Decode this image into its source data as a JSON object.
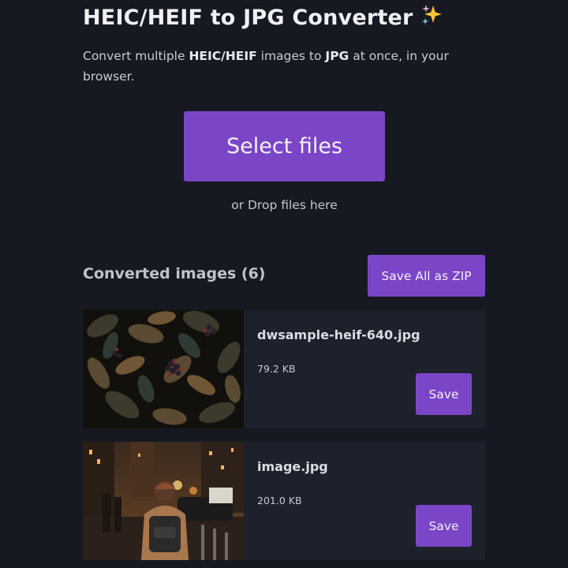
{
  "header": {
    "title": "HEIC/HEIF to JPG Converter",
    "title_icon": "sparkles-icon",
    "subtitle": {
      "prefix": "Convert multiple ",
      "format_from": "HEIC/HEIF",
      "middle": " images to ",
      "format_to": "JPG",
      "suffix": " at once, in your browser."
    }
  },
  "upload": {
    "select_label": "Select files",
    "drop_hint": "or Drop files here"
  },
  "converted": {
    "heading": "Converted images (6)",
    "save_all_label": "Save All as ZIP",
    "items": [
      {
        "filename": "dwsample-heif-640.jpg",
        "size": "79.2 KB",
        "save_label": "Save",
        "thumbnail": "leaves-and-berries-photo"
      },
      {
        "filename": "image.jpg",
        "size": "201.0 KB",
        "save_label": "Save",
        "thumbnail": "city-street-night-photo"
      }
    ]
  },
  "colors": {
    "background": "#161922",
    "card": "#1d212b",
    "accent": "#7a45c6"
  }
}
